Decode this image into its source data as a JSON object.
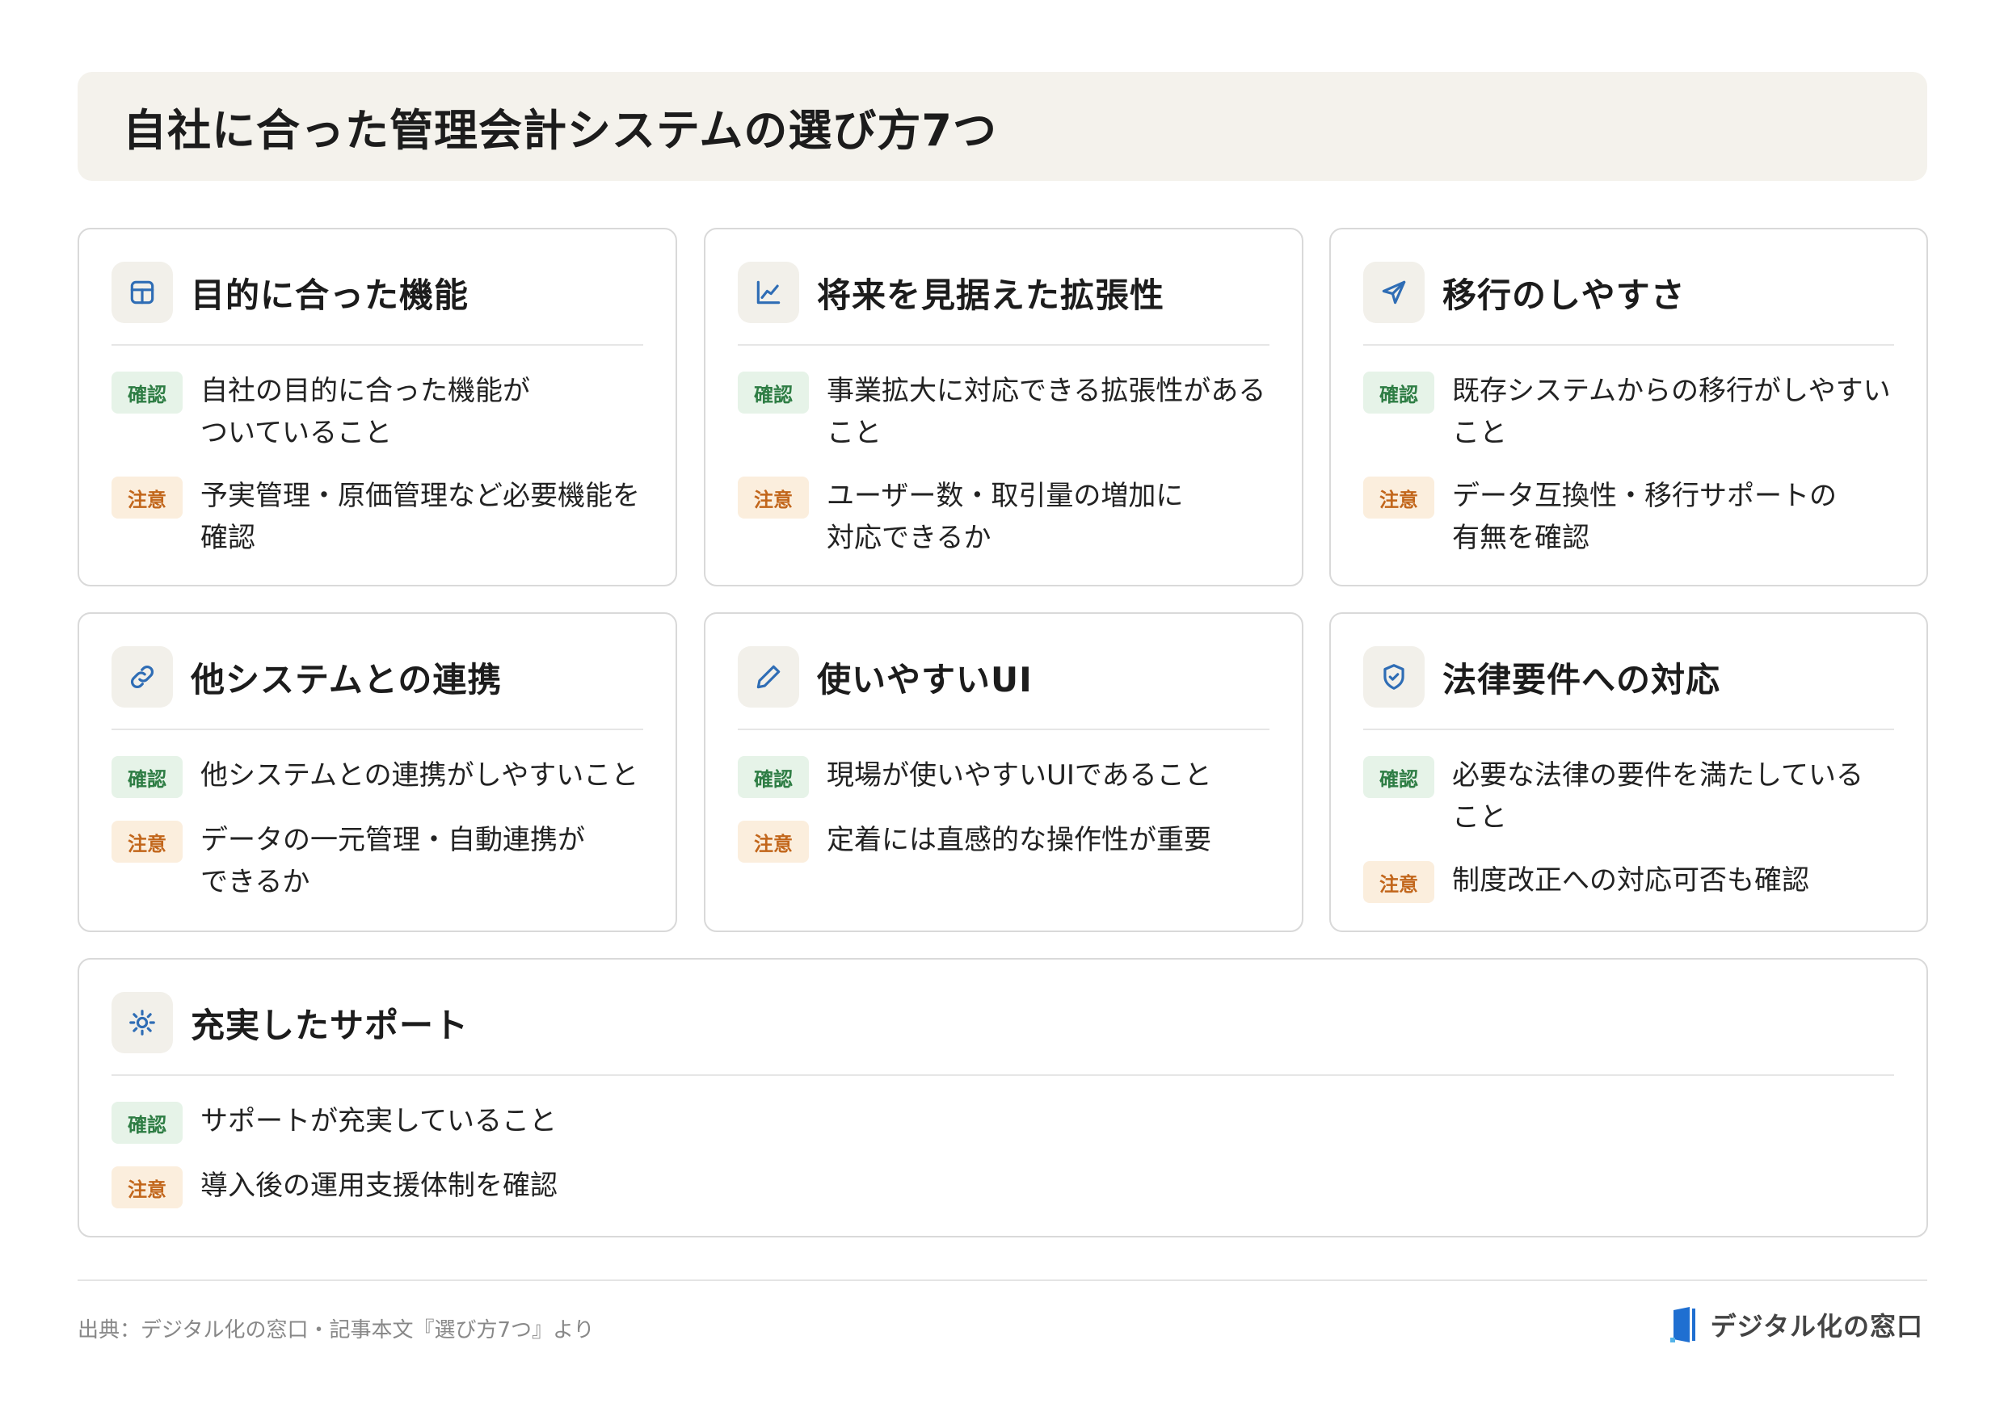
{
  "title": "自社に合った管理会計システムの選び方7つ",
  "labels": {
    "confirm": "確認",
    "caution": "注意"
  },
  "cards": [
    {
      "icon": "table-icon",
      "title": "目的に合った機能",
      "confirm": "自社の目的に合った機能が\nついていること",
      "caution": "予実管理・原価管理など必要機能を\n確認"
    },
    {
      "icon": "chart-line-icon",
      "title": "将来を見据えた拡張性",
      "confirm": "事業拡大に対応できる拡張性がある\nこと",
      "caution": "ユーザー数・取引量の増加に\n対応できるか"
    },
    {
      "icon": "send-icon",
      "title": "移行のしやすさ",
      "confirm": "既存システムからの移行がしやすい\nこと",
      "caution": "データ互換性・移行サポートの\n有無を確認"
    },
    {
      "icon": "link-icon",
      "title": "他システムとの連携",
      "confirm": "他システムとの連携がしやすいこと",
      "caution": "データの一元管理・自動連携が\nできるか"
    },
    {
      "icon": "pencil-icon",
      "title": "使いやすいUI",
      "confirm": "現場が使いやすいUIであること",
      "caution": "定着には直感的な操作性が重要"
    },
    {
      "icon": "shield-check-icon",
      "title": "法律要件への対応",
      "confirm": "必要な法律の要件を満たしている\nこと",
      "caution": "制度改正への対応可否も確認"
    },
    {
      "icon": "sun-icon",
      "title": "充実したサポート",
      "confirm": "サポートが充実していること",
      "caution": "導入後の運用支援体制を確認"
    }
  ],
  "footer": {
    "source": "出典：デジタル化の窓口・記事本文『選び方7つ』より",
    "brand": "デジタル化の窓口"
  },
  "colors": {
    "accent": "#2f6db5",
    "confirm_bg": "#e6f3e8",
    "confirm_fg": "#2e7d44",
    "caution_bg": "#fbeedd",
    "caution_fg": "#c2661b",
    "title_bg": "#f4f2ec"
  }
}
